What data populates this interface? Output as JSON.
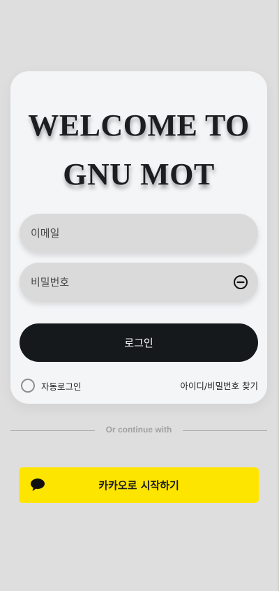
{
  "welcome": {
    "line1": "WELCOME TO",
    "line2": "GNU MOT"
  },
  "form": {
    "email_placeholder": "이메일",
    "password_placeholder": "비밀번호",
    "password_toggle_icon": "minus-circle-icon",
    "login_label": "로그인",
    "auto_login_label": "자동로그인",
    "auto_login_checked": false,
    "find_account_label": "아이디/비밀번호 찾기"
  },
  "divider": {
    "label": "Or continue with"
  },
  "social": {
    "kakao_label": "카카오로 시작하기",
    "kakao_icon": "speech-bubble-icon",
    "kakao_color": "#FEE500"
  },
  "colors": {
    "background": "#DEDEDE",
    "card": "#F4F5F7",
    "login_button": "#16191B",
    "input": "#DADADA"
  }
}
